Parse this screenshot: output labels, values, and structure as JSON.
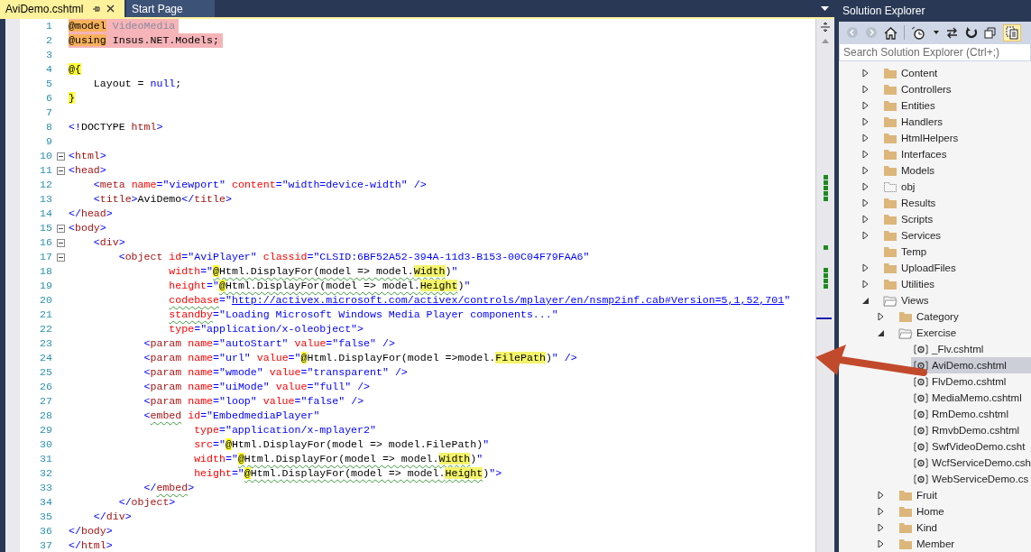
{
  "tabs": [
    {
      "label": "AviDemo.cshtml",
      "selected": true,
      "pinned": true
    },
    {
      "label": "Start Page",
      "selected": false
    }
  ],
  "editor": {
    "lines": [
      {
        "number": "1",
        "directive": true,
        "tokens": [
          {
            "text": "@model",
            "kind": "dirkw"
          },
          {
            "text": " VideoMedia",
            "kind": "type"
          }
        ]
      },
      {
        "number": "2",
        "directive": true,
        "tokens": [
          {
            "text": "@using",
            "kind": "dirkw"
          },
          {
            "text": " Insus.NET.Models;",
            "kind": "plain"
          }
        ]
      },
      {
        "number": "3"
      },
      {
        "number": "4",
        "tokens": [
          {
            "text": "@{",
            "kind": "razor"
          }
        ]
      },
      {
        "number": "5",
        "tokens": [
          {
            "text": "    Layout = ",
            "kind": "plain"
          },
          {
            "text": "null",
            "kind": "kw"
          },
          {
            "text": ";",
            "kind": "plain"
          }
        ]
      },
      {
        "number": "6",
        "tokens": [
          {
            "text": "}",
            "kind": "razor"
          }
        ]
      },
      {
        "number": "7"
      },
      {
        "number": "8",
        "tokens": [
          {
            "text": "<!",
            "kind": "punct"
          },
          {
            "text": "DOCTYPE",
            "kind": "plain"
          },
          {
            "text": " html",
            "kind": "tag"
          },
          {
            "text": ">",
            "kind": "punct"
          }
        ]
      },
      {
        "number": "9"
      },
      {
        "number": "10",
        "fold": true,
        "tokens": [
          {
            "text": "<",
            "kind": "punct"
          },
          {
            "text": "html",
            "kind": "tag"
          },
          {
            "text": ">",
            "kind": "punct"
          }
        ]
      },
      {
        "number": "11",
        "fold": true,
        "tokens": [
          {
            "text": "<",
            "kind": "punct"
          },
          {
            "text": "head",
            "kind": "tag"
          },
          {
            "text": ">",
            "kind": "punct"
          }
        ]
      },
      {
        "number": "12",
        "tokens": [
          {
            "text": "    <",
            "kind": "punct"
          },
          {
            "text": "meta",
            "kind": "tag"
          },
          {
            "text": " name",
            "kind": "attr"
          },
          {
            "text": "=\"viewport\"",
            "kind": "str"
          },
          {
            "text": " content",
            "kind": "attr"
          },
          {
            "text": "=\"width=device-width\"",
            "kind": "str"
          },
          {
            "text": " />",
            "kind": "punct"
          }
        ]
      },
      {
        "number": "13",
        "tokens": [
          {
            "text": "    <",
            "kind": "punct"
          },
          {
            "text": "title",
            "kind": "tag"
          },
          {
            "text": ">",
            "kind": "punct"
          },
          {
            "text": "AviDemo",
            "kind": "plain"
          },
          {
            "text": "</",
            "kind": "punct"
          },
          {
            "text": "title",
            "kind": "tag"
          },
          {
            "text": ">",
            "kind": "punct"
          }
        ]
      },
      {
        "number": "14",
        "tokens": [
          {
            "text": "</",
            "kind": "punct"
          },
          {
            "text": "head",
            "kind": "tag"
          },
          {
            "text": ">",
            "kind": "punct"
          }
        ]
      },
      {
        "number": "15",
        "fold": true,
        "tokens": [
          {
            "text": "<",
            "kind": "punct"
          },
          {
            "text": "body",
            "kind": "tag"
          },
          {
            "text": ">",
            "kind": "punct"
          }
        ]
      },
      {
        "number": "16",
        "fold": true,
        "tokens": [
          {
            "text": "    <",
            "kind": "punct"
          },
          {
            "text": "div",
            "kind": "tag"
          },
          {
            "text": ">",
            "kind": "punct"
          }
        ]
      },
      {
        "number": "17",
        "fold": true,
        "tokens": [
          {
            "text": "        <",
            "kind": "punct"
          },
          {
            "text": "object",
            "kind": "tag"
          },
          {
            "text": " id",
            "kind": "attr"
          },
          {
            "text": "=\"AviPlayer\"",
            "kind": "str"
          },
          {
            "text": " classid",
            "kind": "attr"
          },
          {
            "text": "=\"CLSID:6BF52A52-394A-11d3-B153-00C04F79FAA6\"",
            "kind": "str"
          }
        ]
      },
      {
        "number": "18",
        "tokens": [
          {
            "text": "                width",
            "kind": "attr"
          },
          {
            "text": "=\"",
            "kind": "str"
          },
          {
            "text": "@",
            "kind": "razor",
            "warning": true
          },
          {
            "text": "Html.DisplayFor(model => model.",
            "kind": "plain",
            "warning": true
          },
          {
            "text": "Width",
            "kind": "hl",
            "warning": true
          },
          {
            "text": ")",
            "kind": "plain"
          },
          {
            "text": "\"",
            "kind": "str"
          }
        ]
      },
      {
        "number": "19",
        "tokens": [
          {
            "text": "                height",
            "kind": "attr"
          },
          {
            "text": "=\"",
            "kind": "str"
          },
          {
            "text": "@",
            "kind": "razor",
            "warning": true
          },
          {
            "text": "Html.DisplayFor(model => model.",
            "kind": "plain",
            "warning": true
          },
          {
            "text": "Height",
            "kind": "hl",
            "warning": true
          },
          {
            "text": ")",
            "kind": "plain"
          },
          {
            "text": "\"",
            "kind": "str"
          }
        ]
      },
      {
        "number": "20",
        "tokens": [
          {
            "text": "                codebase",
            "kind": "attr",
            "warning": true
          },
          {
            "text": "=\"",
            "kind": "str"
          },
          {
            "text": "http://activex.microsoft.com/activex/controls/mplayer/en/nsmp2inf.cab#Version=5,1,52,701",
            "kind": "link"
          },
          {
            "text": "\"",
            "kind": "str"
          }
        ]
      },
      {
        "number": "21",
        "tokens": [
          {
            "text": "                standby",
            "kind": "attr",
            "warning": true
          },
          {
            "text": "=\"Loading Microsoft Windows Media Player components...\"",
            "kind": "str"
          }
        ]
      },
      {
        "number": "22",
        "tokens": [
          {
            "text": "                type",
            "kind": "attr"
          },
          {
            "text": "=\"application/x-oleobject\"",
            "kind": "str"
          },
          {
            "text": ">",
            "kind": "punct"
          }
        ]
      },
      {
        "number": "23",
        "tokens": [
          {
            "text": "            <",
            "kind": "punct"
          },
          {
            "text": "param",
            "kind": "tag"
          },
          {
            "text": " name",
            "kind": "attr"
          },
          {
            "text": "=\"autoStart\"",
            "kind": "str"
          },
          {
            "text": " value",
            "kind": "attr"
          },
          {
            "text": "=\"false\"",
            "kind": "str"
          },
          {
            "text": " />",
            "kind": "punct"
          }
        ]
      },
      {
        "number": "24",
        "tokens": [
          {
            "text": "            <",
            "kind": "punct"
          },
          {
            "text": "param",
            "kind": "tag"
          },
          {
            "text": " name",
            "kind": "attr"
          },
          {
            "text": "=\"url\"",
            "kind": "str"
          },
          {
            "text": " value",
            "kind": "attr"
          },
          {
            "text": "=\"",
            "kind": "str"
          },
          {
            "text": "@",
            "kind": "razor"
          },
          {
            "text": "Html.DisplayFor(model =>model.",
            "kind": "plain"
          },
          {
            "text": "FilePath",
            "kind": "hl"
          },
          {
            "text": ")",
            "kind": "plain"
          },
          {
            "text": "\"",
            "kind": "str"
          },
          {
            "text": " />",
            "kind": "punct"
          }
        ]
      },
      {
        "number": "25",
        "tokens": [
          {
            "text": "            <",
            "kind": "punct"
          },
          {
            "text": "param",
            "kind": "tag"
          },
          {
            "text": " name",
            "kind": "attr"
          },
          {
            "text": "=\"wmode\"",
            "kind": "str"
          },
          {
            "text": " value",
            "kind": "attr"
          },
          {
            "text": "=\"transparent\"",
            "kind": "str"
          },
          {
            "text": " />",
            "kind": "punct"
          }
        ]
      },
      {
        "number": "26",
        "tokens": [
          {
            "text": "            <",
            "kind": "punct"
          },
          {
            "text": "param",
            "kind": "tag"
          },
          {
            "text": " name",
            "kind": "attr"
          },
          {
            "text": "=\"uiMode\"",
            "kind": "str"
          },
          {
            "text": " value",
            "kind": "attr"
          },
          {
            "text": "=\"full\"",
            "kind": "str"
          },
          {
            "text": " />",
            "kind": "punct"
          }
        ]
      },
      {
        "number": "27",
        "tokens": [
          {
            "text": "            <",
            "kind": "punct"
          },
          {
            "text": "param",
            "kind": "tag"
          },
          {
            "text": " name",
            "kind": "attr"
          },
          {
            "text": "=\"loop\"",
            "kind": "str"
          },
          {
            "text": " value",
            "kind": "attr"
          },
          {
            "text": "=\"false\"",
            "kind": "str"
          },
          {
            "text": " />",
            "kind": "punct"
          }
        ]
      },
      {
        "number": "28",
        "tokens": [
          {
            "text": "            <",
            "kind": "punct"
          },
          {
            "text": "embed",
            "kind": "tag",
            "warning": true
          },
          {
            "text": " id",
            "kind": "attr"
          },
          {
            "text": "=\"EmbedmediaPlayer\"",
            "kind": "str"
          }
        ]
      },
      {
        "number": "29",
        "tokens": [
          {
            "text": "                    type",
            "kind": "attr"
          },
          {
            "text": "=\"application/x-mplayer2\"",
            "kind": "str"
          }
        ]
      },
      {
        "number": "30",
        "tokens": [
          {
            "text": "                    src",
            "kind": "attr"
          },
          {
            "text": "=\"",
            "kind": "str"
          },
          {
            "text": "@",
            "kind": "razor"
          },
          {
            "text": "Html.DisplayFor(model => model.FilePath)",
            "kind": "plain"
          },
          {
            "text": "\"",
            "kind": "str"
          }
        ]
      },
      {
        "number": "31",
        "tokens": [
          {
            "text": "                    width",
            "kind": "attr"
          },
          {
            "text": "=\"",
            "kind": "str"
          },
          {
            "text": "@",
            "kind": "razor",
            "warning": true
          },
          {
            "text": "Html.DisplayFor(model => model.",
            "kind": "plain",
            "warning": true
          },
          {
            "text": "Width",
            "kind": "hl",
            "warning": true
          },
          {
            "text": ")",
            "kind": "plain"
          },
          {
            "text": "\"",
            "kind": "str"
          }
        ]
      },
      {
        "number": "32",
        "tokens": [
          {
            "text": "                    height",
            "kind": "attr"
          },
          {
            "text": "=\"",
            "kind": "str"
          },
          {
            "text": "@",
            "kind": "razor",
            "warning": true
          },
          {
            "text": "Html.DisplayFor(model => model.",
            "kind": "plain",
            "warning": true
          },
          {
            "text": "Height",
            "kind": "hl",
            "warning": true
          },
          {
            "text": ")",
            "kind": "plain"
          },
          {
            "text": "\"",
            "kind": "str"
          },
          {
            "text": ">",
            "kind": "punct"
          }
        ]
      },
      {
        "number": "33",
        "tokens": [
          {
            "text": "            </",
            "kind": "punct"
          },
          {
            "text": "embed",
            "kind": "tag",
            "warning": true
          },
          {
            "text": ">",
            "kind": "punct"
          }
        ]
      },
      {
        "number": "34",
        "tokens": [
          {
            "text": "        </",
            "kind": "punct"
          },
          {
            "text": "object",
            "kind": "tag"
          },
          {
            "text": ">",
            "kind": "punct"
          }
        ]
      },
      {
        "number": "35",
        "tokens": [
          {
            "text": "    </",
            "kind": "punct"
          },
          {
            "text": "div",
            "kind": "tag"
          },
          {
            "text": ">",
            "kind": "punct"
          }
        ]
      },
      {
        "number": "36",
        "tokens": [
          {
            "text": "</",
            "kind": "punct"
          },
          {
            "text": "body",
            "kind": "tag"
          },
          {
            "text": ">",
            "kind": "punct"
          }
        ]
      },
      {
        "number": "37",
        "tokens": [
          {
            "text": "</",
            "kind": "punct"
          },
          {
            "text": "html",
            "kind": "tag"
          },
          {
            "text": ">",
            "kind": "punct"
          }
        ]
      }
    ]
  },
  "solution_explorer": {
    "title": "Solution Explorer",
    "search": {
      "placeholder": "Search Solution Explorer (Ctrl+;)"
    },
    "tree": [
      {
        "label": "Content",
        "kind": "folder",
        "expanded": false,
        "selected": false
      },
      {
        "label": "Controllers",
        "kind": "folder",
        "expanded": false,
        "selected": false
      },
      {
        "label": "Entities",
        "kind": "folder",
        "expanded": false,
        "selected": false
      },
      {
        "label": "Handlers",
        "kind": "folder",
        "expanded": false,
        "selected": false
      },
      {
        "label": "HtmlHelpers",
        "kind": "folder",
        "expanded": false,
        "selected": false
      },
      {
        "label": "Interfaces",
        "kind": "folder",
        "expanded": false,
        "selected": false
      },
      {
        "label": "Models",
        "kind": "folder",
        "expanded": false,
        "selected": false
      },
      {
        "label": "obj",
        "kind": "excluded-folder",
        "expanded": false,
        "selected": false
      },
      {
        "label": "Results",
        "kind": "folder",
        "expanded": false,
        "selected": false
      },
      {
        "label": "Scripts",
        "kind": "folder",
        "expanded": false,
        "selected": false
      },
      {
        "label": "Services",
        "kind": "folder",
        "expanded": false,
        "selected": false
      },
      {
        "label": "Temp",
        "kind": "folder",
        "selected": false
      },
      {
        "label": "UploadFiles",
        "kind": "folder",
        "expanded": false,
        "selected": false
      },
      {
        "label": "Utilities",
        "kind": "folder",
        "expanded": false,
        "selected": false
      },
      {
        "label": "Views",
        "kind": "folder",
        "expanded": true,
        "selected": false,
        "children": [
          {
            "label": "Category",
            "kind": "folder",
            "expanded": false,
            "selected": false
          },
          {
            "label": "Exercise",
            "kind": "folder",
            "expanded": true,
            "selected": false,
            "children": [
              {
                "label": "_Flv.cshtml",
                "kind": "file",
                "selected": false
              },
              {
                "label": "AviDemo.cshtml",
                "kind": "file",
                "selected": true
              },
              {
                "label": "FlvDemo.cshtml",
                "kind": "file",
                "selected": false
              },
              {
                "label": "MediaMemo.cshtml",
                "kind": "file",
                "selected": false
              },
              {
                "label": "RmDemo.cshtml",
                "kind": "file",
                "selected": false
              },
              {
                "label": "RmvbDemo.cshtml",
                "kind": "file",
                "selected": false
              },
              {
                "label": "SwfVideoDemo.csht",
                "kind": "file",
                "selected": false
              },
              {
                "label": "WcfServiceDemo.csh",
                "kind": "file",
                "selected": false
              },
              {
                "label": "WebServiceDemo.cs",
                "kind": "file",
                "selected": false
              }
            ]
          },
          {
            "label": "Fruit",
            "kind": "folder",
            "expanded": false,
            "selected": false
          },
          {
            "label": "Home",
            "kind": "folder",
            "expanded": false,
            "selected": false
          },
          {
            "label": "Kind",
            "kind": "folder",
            "expanded": false,
            "selected": false
          },
          {
            "label": "Member",
            "kind": "folder",
            "expanded": false,
            "selected": false
          }
        ]
      }
    ]
  }
}
